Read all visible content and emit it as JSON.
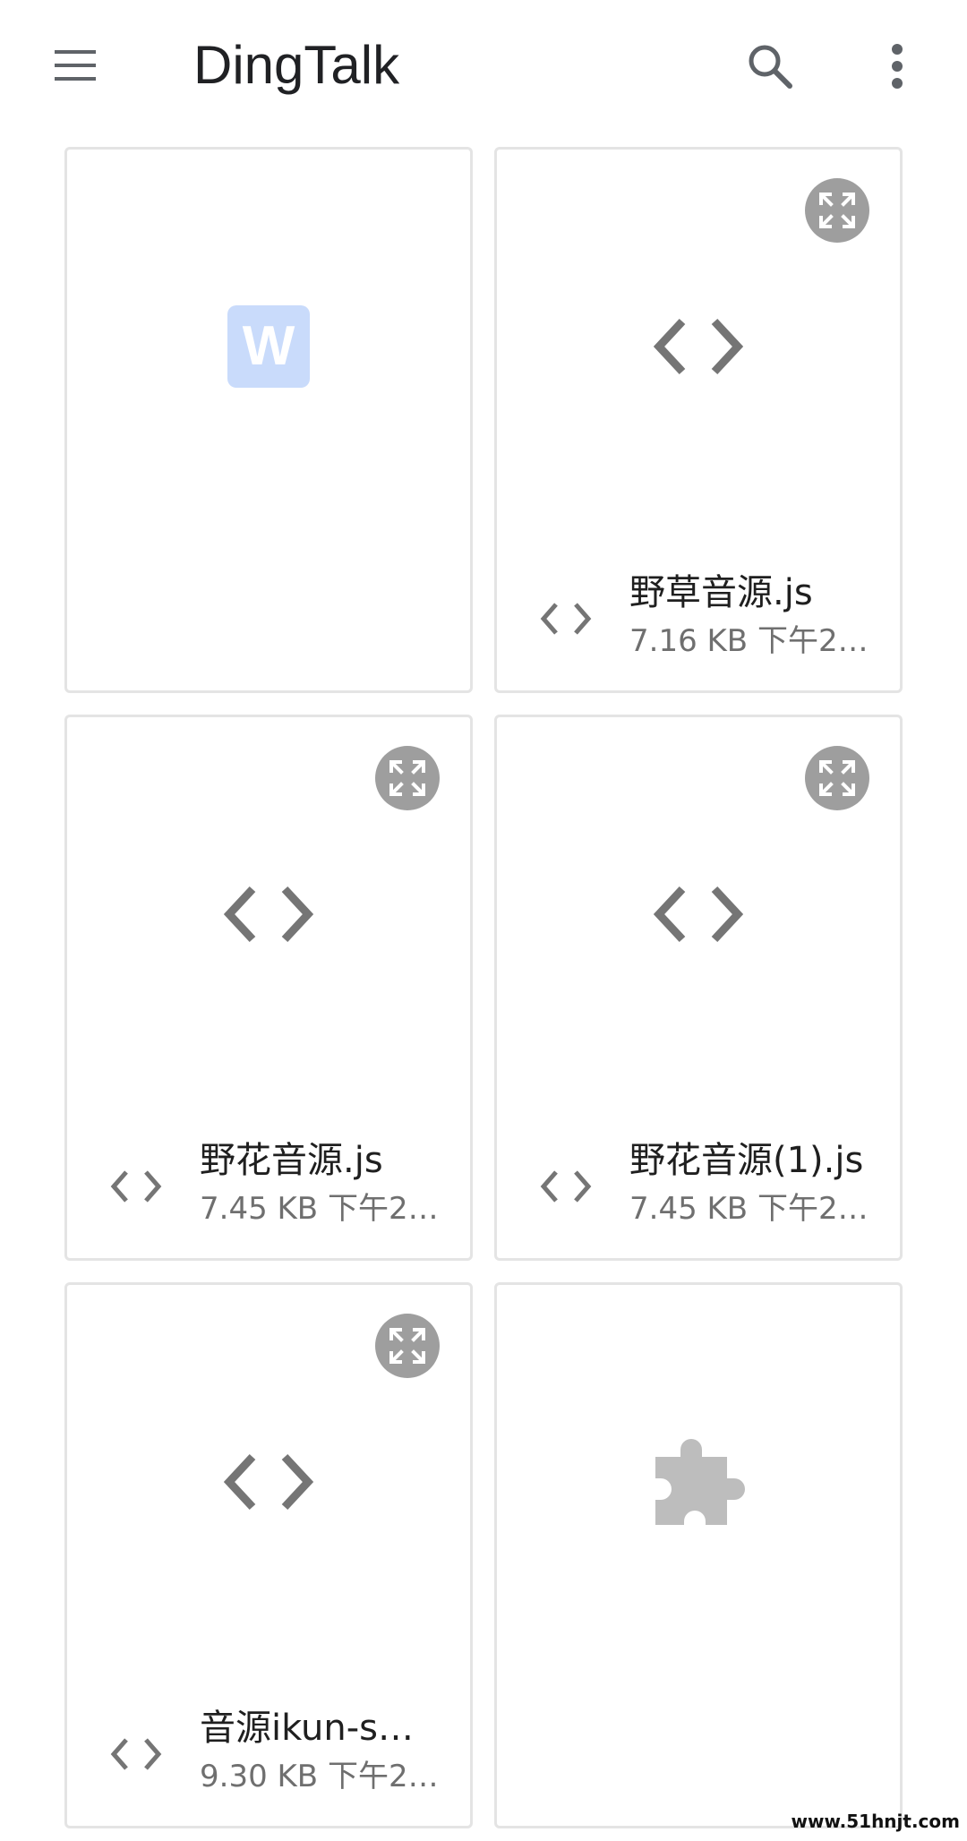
{
  "app_bar": {
    "title": "DingTalk",
    "icons": {
      "menu": "menu-icon",
      "search": "search-icon",
      "more": "more-vert-icon"
    }
  },
  "files": [
    {
      "type": "word-document",
      "preview_icon": "word-icon",
      "preview_letter": "W",
      "name": "",
      "meta": "",
      "expandable": false
    },
    {
      "type": "code",
      "preview_icon": "code-icon",
      "name": "野草音源.js",
      "meta": "7.16 KB 下午2…",
      "expandable": true
    },
    {
      "type": "code",
      "preview_icon": "code-icon",
      "name": "野花音源.js",
      "meta": "7.45 KB 下午2…",
      "expandable": true
    },
    {
      "type": "code",
      "preview_icon": "code-icon",
      "name": "野花音源(1).js",
      "meta": "7.45 KB 下午2…",
      "expandable": true
    },
    {
      "type": "code",
      "preview_icon": "code-icon",
      "name": "音源ikun-s…",
      "meta": "9.30 KB 下午2…",
      "expandable": true
    },
    {
      "type": "extension",
      "preview_icon": "puzzle-piece-icon",
      "name": "",
      "meta": "",
      "expandable": false
    }
  ],
  "watermark": "www.51hnjt.com",
  "colors": {
    "icon_dark": "#5f6368",
    "code_icon": "#757575",
    "expand_badge": "#9e9e9e",
    "word_icon_bg": "#c9dbfb",
    "puzzle_icon": "#bdbdbd",
    "card_border": "#e4e4e4"
  }
}
